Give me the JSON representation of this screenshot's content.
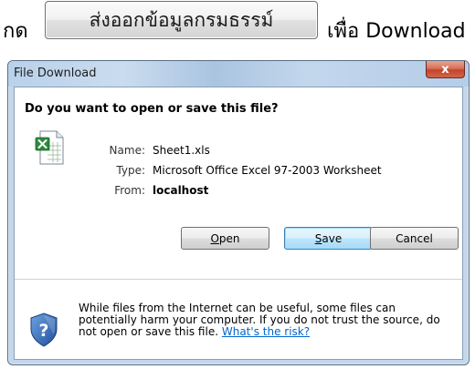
{
  "instruction": {
    "prefix": "กด",
    "button_label": "ส่งออกข้อมูลกรมธรรม์",
    "suffix": "เพื่อ Download"
  },
  "dialog": {
    "title": "File Download",
    "close_label": "x",
    "question": "Do you want to open or save this file?",
    "file_icon": "excel-file-icon",
    "fields": {
      "name_label": "Name:",
      "name_value": "Sheet1.xls",
      "type_label": "Type:",
      "type_value": "Microsoft Office Excel 97-2003 Worksheet",
      "from_label": "From:",
      "from_value": "localhost"
    },
    "buttons": {
      "open_mnemonic": "O",
      "open_rest": "pen",
      "save_mnemonic": "S",
      "save_rest": "ave",
      "cancel": "Cancel"
    },
    "warning": {
      "icon": "shield-question-icon",
      "text": "While files from the Internet can be useful, some files can potentially harm your computer. If you do not trust the source, do not open or save this file.",
      "link": "What's the risk?"
    }
  },
  "colors": {
    "link": "#0066cc",
    "close_button": "#c2442b",
    "title_bar": "#b9d1ea"
  }
}
